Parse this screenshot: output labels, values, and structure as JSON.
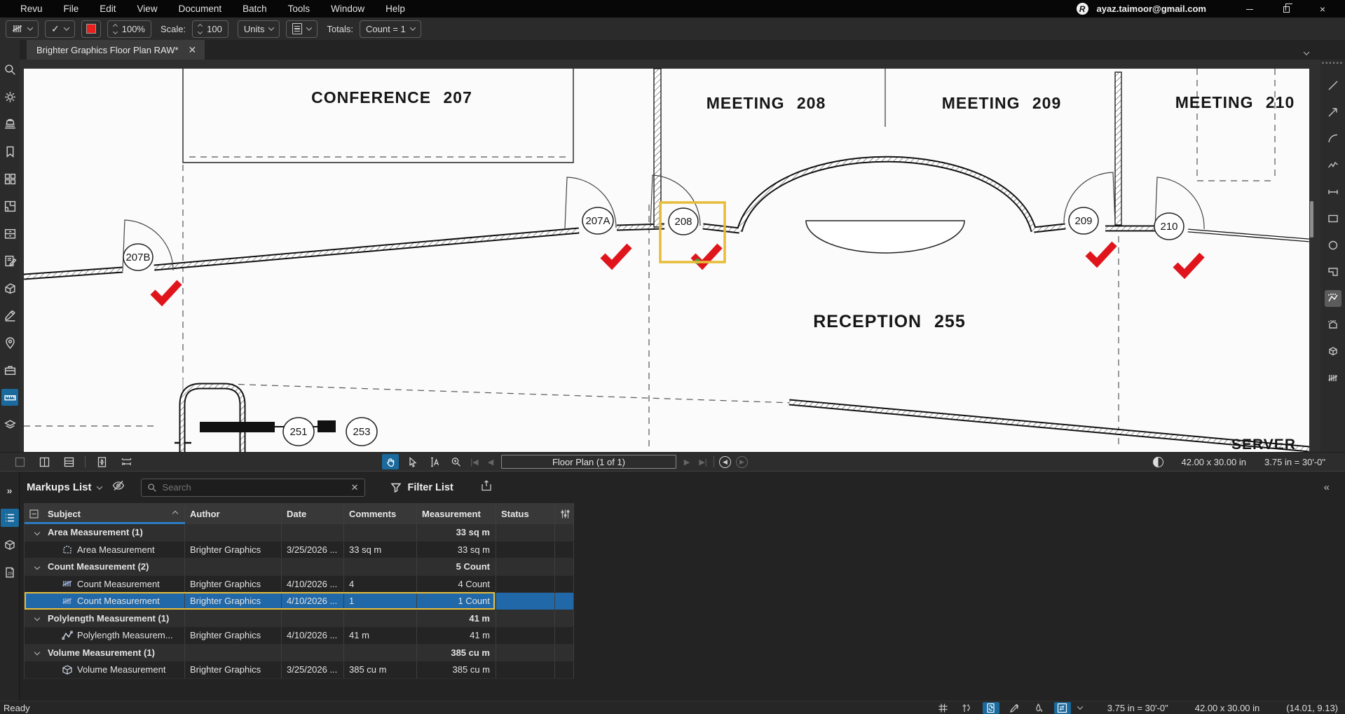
{
  "window": {
    "account": "ayaz.taimoor@gmail.com"
  },
  "menu": {
    "items": [
      "Revu",
      "File",
      "Edit",
      "View",
      "Document",
      "Batch",
      "Tools",
      "Window",
      "Help"
    ]
  },
  "toolbar": {
    "zoom_value": "100%",
    "scale_label": "Scale:",
    "scale_value": "100",
    "units_label": "Units",
    "totals_label": "Totals:",
    "totals_value": "Count = 1"
  },
  "tab": {
    "title": "Brighter Graphics Floor Plan RAW*"
  },
  "navbar": {
    "page_label": "Floor Plan (1 of 1)",
    "page_size": "42.00 x 30.00 in",
    "scale": "3.75 in = 30'-0\""
  },
  "floorplan": {
    "conference": "CONFERENCE 207",
    "meeting208": "MEETING 208",
    "meeting209": "MEETING 209",
    "meeting210": "MEETING 210",
    "reception": "RECEPTION 255",
    "server": "SERVER",
    "doors": {
      "d207b": "207B",
      "d207a": "207A",
      "d208": "208",
      "d209": "209",
      "d210": "210",
      "d251": "251",
      "d253": "253"
    }
  },
  "markups_panel": {
    "title": "Markups List",
    "search_placeholder": "Search",
    "filter_label": "Filter List",
    "columns": [
      "Subject",
      "Author",
      "Date",
      "Comments",
      "Measurement",
      "Status"
    ],
    "rows": [
      {
        "type": "group",
        "subject": "Area Measurement (1)",
        "author": "",
        "date": "",
        "comments": "",
        "measurement": "33 sq m"
      },
      {
        "type": "item",
        "icon": "area-icon",
        "subject": "Area Measurement",
        "author": "Brighter Graphics",
        "date": "3/25/2026 ...",
        "comments": "33 sq m",
        "measurement": "33 sq m"
      },
      {
        "type": "group",
        "subject": "Count Measurement (2)",
        "author": "",
        "date": "",
        "comments": "",
        "measurement": "5 Count"
      },
      {
        "type": "item",
        "icon": "count-icon",
        "subject": "Count Measurement",
        "author": "Brighter Graphics",
        "date": "4/10/2026 ...",
        "comments": "4",
        "measurement": "4 Count"
      },
      {
        "type": "item",
        "icon": "count-icon",
        "subject": "Count Measurement",
        "author": "Brighter Graphics",
        "date": "4/10/2026 ...",
        "comments": "1",
        "measurement": "1 Count",
        "selected": true
      },
      {
        "type": "group",
        "subject": "Polylength Measurement (1)",
        "author": "",
        "date": "",
        "comments": "",
        "measurement": "41 m"
      },
      {
        "type": "item",
        "icon": "polylength-icon",
        "subject": "Polylength Measurem...",
        "author": "Brighter Graphics",
        "date": "4/10/2026 ...",
        "comments": "41 m",
        "measurement": "41 m"
      },
      {
        "type": "group",
        "subject": "Volume Measurement (1)",
        "author": "",
        "date": "",
        "comments": "",
        "measurement": "385 cu m"
      },
      {
        "type": "item",
        "icon": "volume-icon",
        "subject": "Volume Measurement",
        "author": "Brighter Graphics",
        "date": "3/25/2026 ...",
        "comments": "385 cu m",
        "measurement": "385 cu m"
      }
    ]
  },
  "statusbar": {
    "ready": "Ready",
    "scale": "3.75 in = 30'-0\"",
    "page_size": "42.00 x 30.00 in",
    "coords": "(14.01, 9.13)"
  },
  "colors": {
    "accent_blue": "#1a6a9e",
    "selection_blue": "#2068a8",
    "highlight_yellow": "#e7bc3a",
    "check_red": "#e0151b"
  }
}
